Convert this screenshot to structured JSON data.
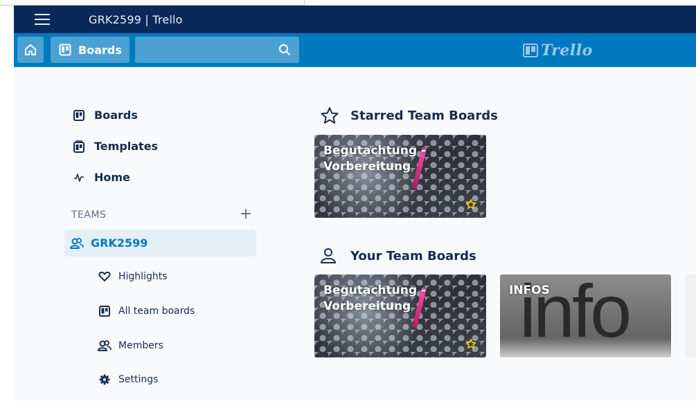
{
  "window": {
    "title": "GRK2599 | Trello"
  },
  "header": {
    "boards_label": "Boards",
    "search": {
      "value": "",
      "placeholder": ""
    },
    "logo_text": "Trello",
    "colors": {
      "titlebar": "#09295a",
      "header": "#0079bf"
    }
  },
  "sidebar": {
    "items": [
      {
        "label": "Boards",
        "icon": "board-icon"
      },
      {
        "label": "Templates",
        "icon": "template-icon"
      },
      {
        "label": "Home",
        "icon": "pulse-icon"
      }
    ],
    "teams_heading": "TEAMS",
    "add_team_symbol": "+",
    "team": {
      "name": "GRK2599",
      "icon": "team-icon",
      "subitems": [
        {
          "label": "Highlights",
          "icon": "heart-icon"
        },
        {
          "label": "All team boards",
          "icon": "board-icon"
        },
        {
          "label": "Members",
          "icon": "members-icon"
        },
        {
          "label": "Settings",
          "icon": "gear-icon"
        }
      ]
    }
  },
  "main": {
    "starred": {
      "title": "Starred Team Boards",
      "boards": [
        {
          "name": "Begutachtung - Vorbereitung",
          "starred": true
        }
      ]
    },
    "team_boards": {
      "title": "Your Team Boards",
      "boards": [
        {
          "name": "Begutachtung - Vorbereitung",
          "starred": true
        },
        {
          "name": "INFOS",
          "background_text": "info",
          "starred": false
        }
      ]
    }
  }
}
